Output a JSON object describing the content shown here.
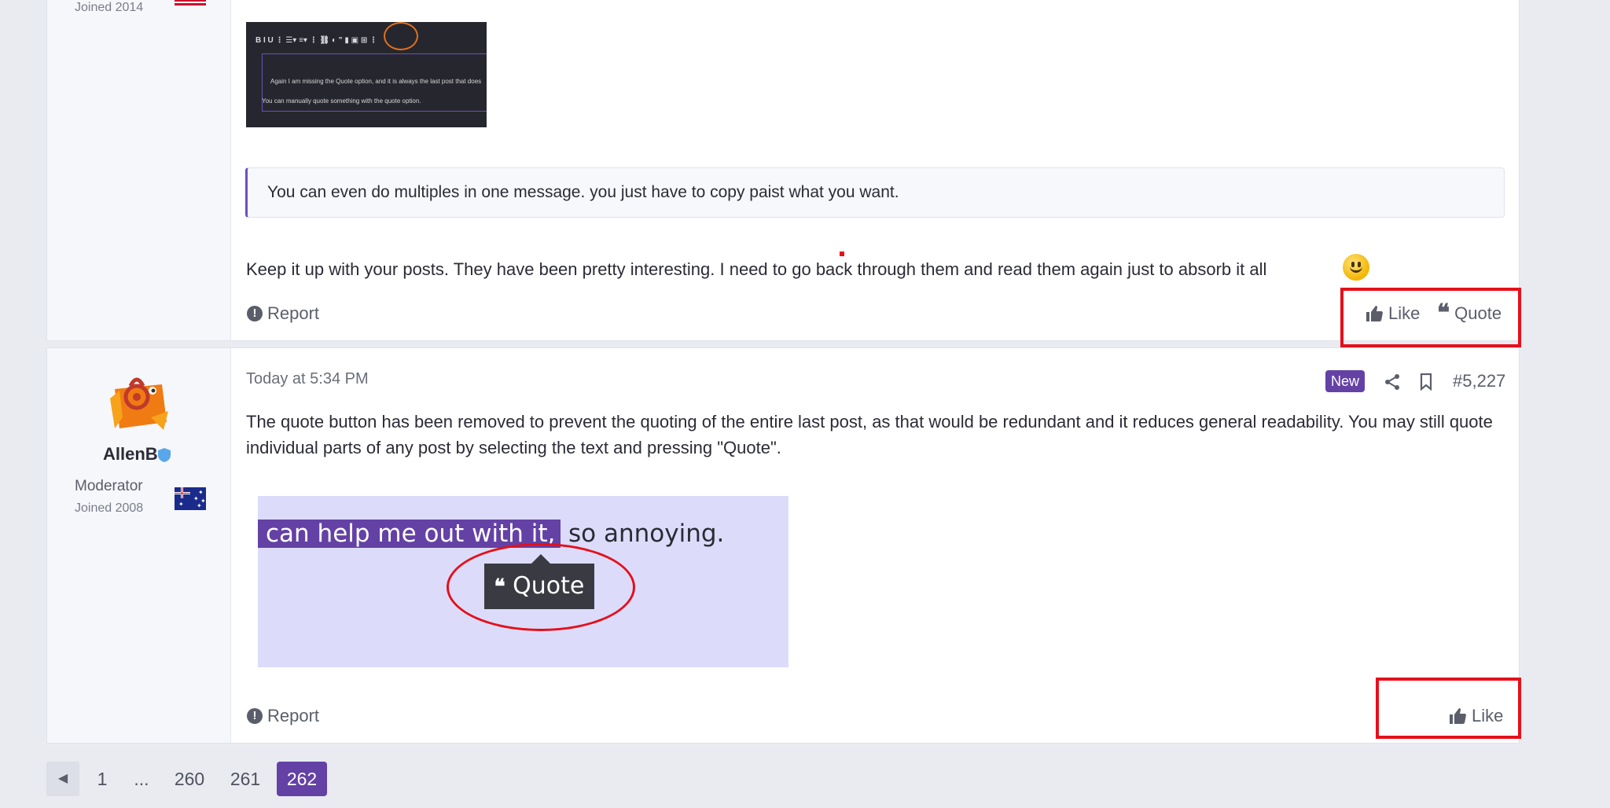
{
  "post1": {
    "joined": "Joined 2014",
    "screenshot": {
      "toolbar": "B  I  U  ⋮   ☰▾  ≡▾   ⋮     ⛓  ◐  \"  ▮  ▣  ⊞  ⋮",
      "text1": "Again I am missing the Quote option, and it is always the last post that does",
      "text2": "You can manually quote something with the quote option."
    },
    "quote_text": "You can even do multiples in one message. you just have to copy paist what you want.",
    "body_text": "Keep it up with your posts. They have been pretty interesting. I need to go back through them and read them again just to absorb it all",
    "report": "Report",
    "like": "Like",
    "quote": "Quote"
  },
  "post2": {
    "username": "AllenB",
    "role": "Moderator",
    "joined": "Joined 2008",
    "date": "Today at 5:34 PM",
    "badge": "New",
    "post_number": "#5,227",
    "body_text": "The quote button has been removed to prevent the quoting of the entire last post, as that would be redundant and it reduces general readability. You may still quote individual parts of any post by selecting the text and pressing \"Quote\".",
    "screenshot": {
      "highlighted": "can help me out with it,",
      "rest": "so annoying.",
      "tooltip": "Quote"
    },
    "report": "Report",
    "like": "Like"
  },
  "pagination": {
    "pages": [
      "1",
      "...",
      "260",
      "261",
      "262"
    ],
    "current": "262"
  },
  "colors": {
    "accent": "#6441a5",
    "annotation_red": "#e5101a"
  }
}
